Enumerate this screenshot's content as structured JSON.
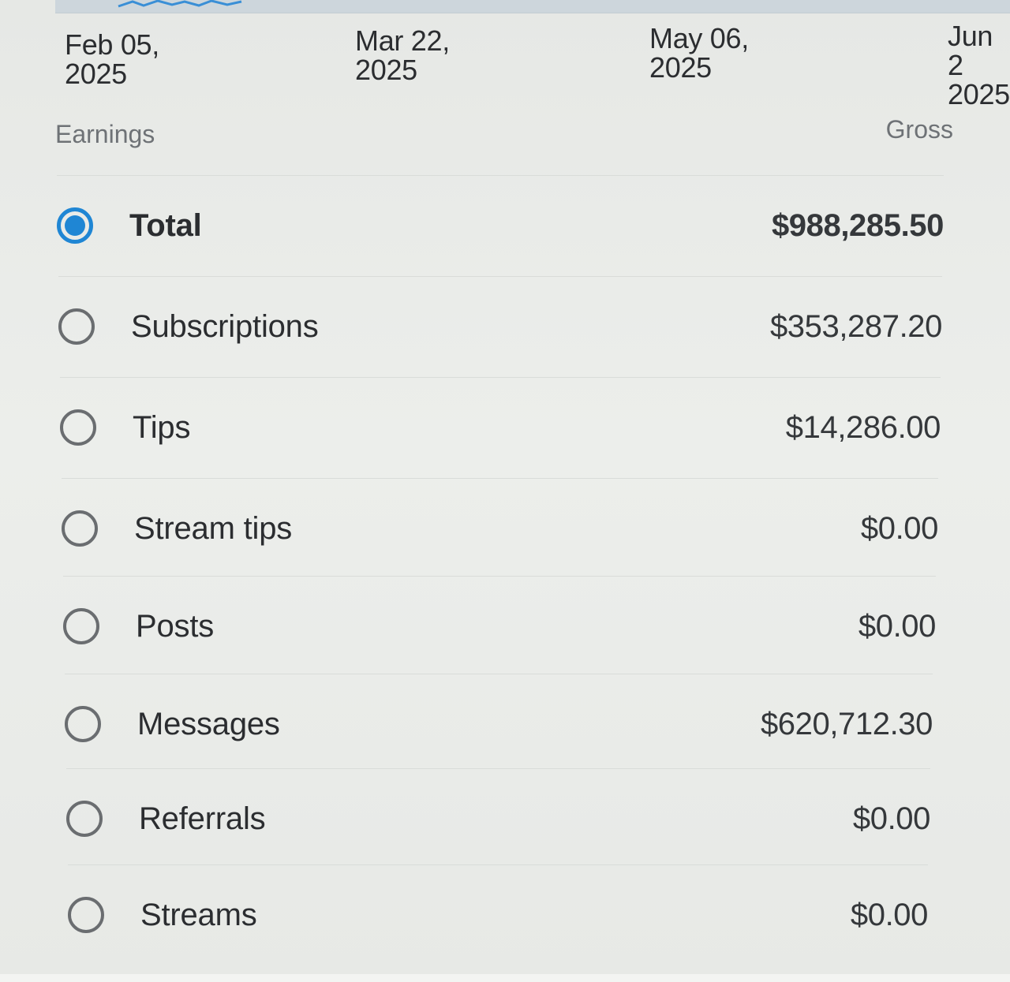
{
  "timeline": {
    "dates": [
      "Feb 05,\n2025",
      "Mar 22,\n2025",
      "May 06,\n2025",
      "Jun 2\n2025"
    ]
  },
  "table": {
    "left_header": "Earnings",
    "right_header": "Gross",
    "rows": [
      {
        "label": "Total",
        "amount": "$988,285.50",
        "selected": true
      },
      {
        "label": "Subscriptions",
        "amount": "$353,287.20",
        "selected": false
      },
      {
        "label": "Tips",
        "amount": "$14,286.00",
        "selected": false
      },
      {
        "label": "Stream tips",
        "amount": "$0.00",
        "selected": false
      },
      {
        "label": "Posts",
        "amount": "$0.00",
        "selected": false
      },
      {
        "label": "Messages",
        "amount": "$620,712.30",
        "selected": false
      },
      {
        "label": "Referrals",
        "amount": "$0.00",
        "selected": false
      },
      {
        "label": "Streams",
        "amount": "$0.00",
        "selected": false
      }
    ]
  },
  "colors": {
    "accent": "#1f86d4",
    "chart_line": "#3a8fd6"
  }
}
